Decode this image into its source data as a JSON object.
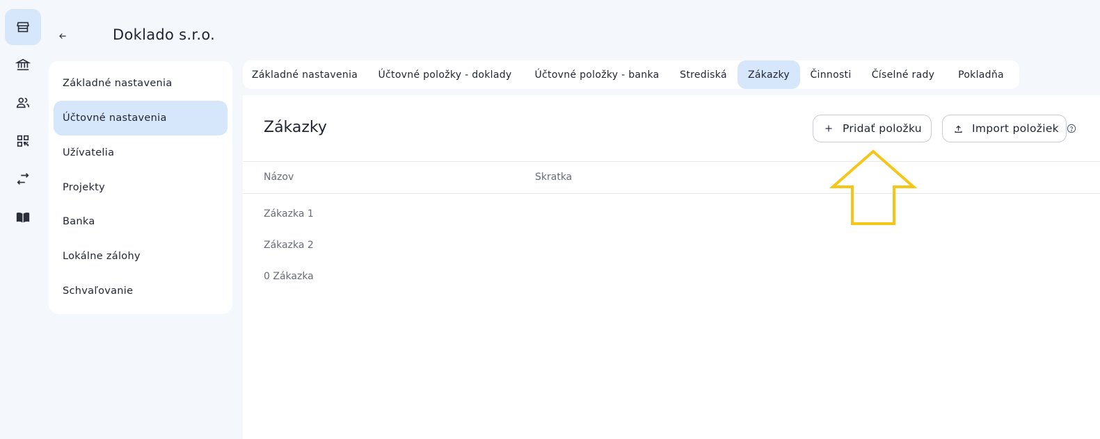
{
  "rail": {
    "items": [
      {
        "icon": "store-icon",
        "active": true
      },
      {
        "icon": "bank-icon",
        "active": false
      },
      {
        "icon": "users-icon",
        "active": false
      },
      {
        "icon": "qr-code-icon",
        "active": false
      },
      {
        "icon": "transfer-icon",
        "active": false
      },
      {
        "icon": "book-icon",
        "active": false
      }
    ]
  },
  "header": {
    "company_name": "Doklado s.r.o."
  },
  "sidebar": {
    "items": [
      {
        "label": "Základné nastavenia",
        "active": false
      },
      {
        "label": "Účtovné nastavenia",
        "active": true
      },
      {
        "label": "Užívatelia",
        "active": false
      },
      {
        "label": "Projekty",
        "active": false
      },
      {
        "label": "Banka",
        "active": false
      },
      {
        "label": "Lokálne zálohy",
        "active": false
      },
      {
        "label": "Schvaľovanie",
        "active": false
      }
    ]
  },
  "tabs": [
    {
      "label": "Základné nastavenia",
      "active": false
    },
    {
      "label": "Účtovné položky - doklady",
      "active": false
    },
    {
      "label": "Účtovné položky - banka",
      "active": false
    },
    {
      "label": "Strediská",
      "active": false
    },
    {
      "label": "Zákazky",
      "active": true
    },
    {
      "label": "Činnosti",
      "active": false
    },
    {
      "label": "Číselné rady",
      "active": false
    },
    {
      "label": "Pokladňa",
      "active": false
    }
  ],
  "main": {
    "title": "Zákazky",
    "add_button": "Pridať položku",
    "import_button": "Import položiek",
    "columns": [
      "Názov",
      "Skratka"
    ],
    "rows": [
      {
        "name": "Zákazka 1",
        "short": ""
      },
      {
        "name": "Zákazka 2",
        "short": ""
      },
      {
        "name": "0 Zákazka",
        "short": ""
      }
    ]
  },
  "annotation": {
    "arrow_color": "#f5c518"
  }
}
